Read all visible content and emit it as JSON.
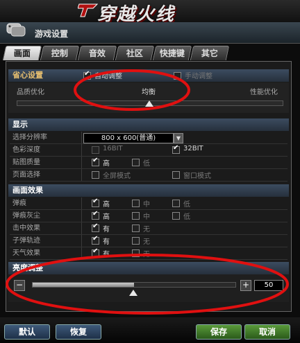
{
  "banner": {
    "logo_text": "穿越火线"
  },
  "header": {
    "title": "游戏设置"
  },
  "tabs": [
    {
      "label": "画面",
      "active": true
    },
    {
      "label": "控制",
      "active": false
    },
    {
      "label": "音效",
      "active": false
    },
    {
      "label": "社区",
      "active": false
    },
    {
      "label": "快捷键",
      "active": false
    },
    {
      "label": "其它",
      "active": false
    }
  ],
  "config": {
    "title": "省心设置",
    "auto_label": "自动调整",
    "auto_checked": true,
    "manual_label": "手动调整",
    "manual_checked": false,
    "quality_label": "品质优化",
    "balance_label": "均衡",
    "performance_label": "性能优化",
    "slider_level": 0.5
  },
  "display": {
    "title": "显示",
    "resolution_label": "选择分辨率",
    "resolution_value": "800 x 600(普通)",
    "color_depth_label": "色彩深度",
    "color_16": "16BIT",
    "color_16_checked": false,
    "color_32": "32BIT",
    "color_32_checked": true,
    "texture_label": "贴图质量",
    "texture_high": "高",
    "texture_high_checked": true,
    "texture_low": "低",
    "texture_low_checked": false,
    "page_label": "页面选择",
    "fullscreen": "全屏模式",
    "fullscreen_checked": false,
    "windowed": "窗口模式",
    "windowed_checked": false
  },
  "effects": {
    "title": "画面效果",
    "rows": [
      {
        "label": "弹痕",
        "options": [
          {
            "text": "高",
            "checked": true
          },
          {
            "text": "中",
            "checked": false
          },
          {
            "text": "低",
            "checked": false
          }
        ]
      },
      {
        "label": "弹痕灰尘",
        "options": [
          {
            "text": "高",
            "checked": true
          },
          {
            "text": "中",
            "checked": false
          },
          {
            "text": "低",
            "checked": false
          }
        ]
      },
      {
        "label": "击中效果",
        "options": [
          {
            "text": "有",
            "checked": true
          },
          {
            "text": "无",
            "checked": false
          }
        ]
      },
      {
        "label": "子弹轨迹",
        "options": [
          {
            "text": "有",
            "checked": true
          },
          {
            "text": "无",
            "checked": false
          }
        ]
      },
      {
        "label": "天气效果",
        "options": [
          {
            "text": "有",
            "checked": true
          },
          {
            "text": "无",
            "checked": false
          }
        ]
      }
    ]
  },
  "brightness": {
    "title": "亮度调整",
    "minus": "−",
    "plus": "+",
    "value": "50",
    "level": 0.5
  },
  "buttons": {
    "default": "默认",
    "restore": "恢复",
    "save": "保存",
    "cancel": "取消"
  },
  "colors": {
    "highlight_circle": "#e01010",
    "section_header": "#3c4c60"
  }
}
